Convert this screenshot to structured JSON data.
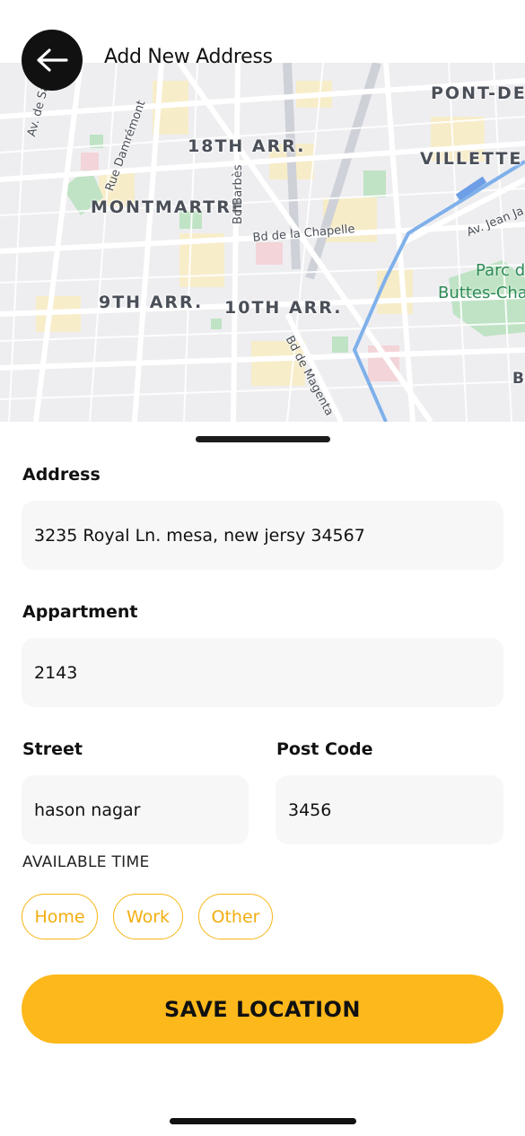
{
  "header": {
    "title": "Add New Address",
    "back_icon": "arrow-left-icon"
  },
  "map": {
    "districts": [
      "18TH ARR.",
      "MONTMARTRE",
      "9TH ARR.",
      "10TH ARR.",
      "VILLETTE",
      "PONT-DE-F"
    ],
    "streets": [
      "Av. de Saint-Ouen",
      "Rue Damrémont",
      "Bd Barbès",
      "Bd de la Chapelle",
      "Bd de Magenta",
      "Av. Jean Ja"
    ],
    "park": [
      "Parc d",
      "Buttes-Cha"
    ],
    "edge_letter": "B"
  },
  "form": {
    "address_label": "Address",
    "address_value": "3235 Royal Ln. mesa, new jersy 34567",
    "apartment_label": "Appartment",
    "apartment_value": "2143",
    "street_label": "Street",
    "street_value": "hason nagar",
    "postcode_label": "Post Code",
    "postcode_value": "3456",
    "available_time_label": "AVAILABLE TIME",
    "chips": [
      "Home",
      "Work",
      "Other"
    ]
  },
  "save_button": "SAVE LOCATION",
  "colors": {
    "accent": "#fdb81b",
    "chip_text": "#f2ad10",
    "field_bg": "#f7f7f8",
    "map_bg": "#eeeef1"
  }
}
